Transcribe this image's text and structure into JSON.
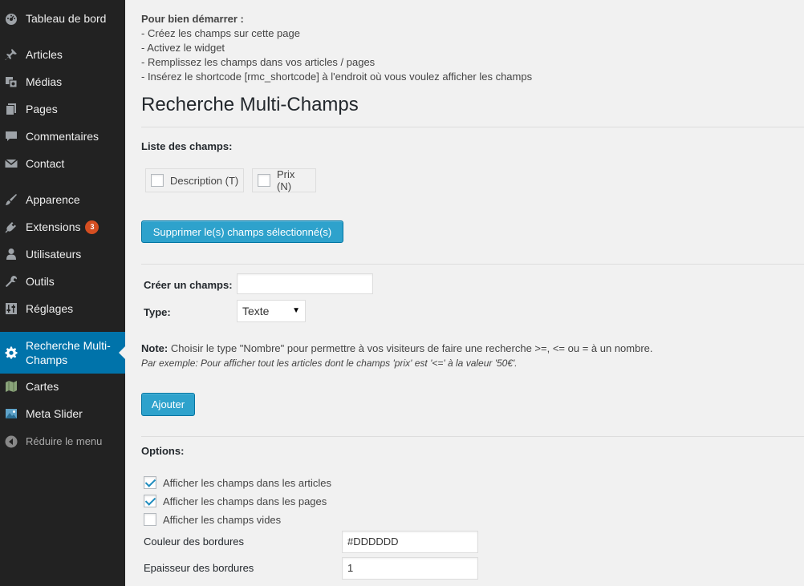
{
  "sidebar": {
    "items": [
      {
        "label": "Tableau de bord",
        "icon": "dashboard-icon"
      },
      {
        "label": "Articles",
        "icon": "pin-icon"
      },
      {
        "label": "Médias",
        "icon": "media-icon"
      },
      {
        "label": "Pages",
        "icon": "pages-icon"
      },
      {
        "label": "Commentaires",
        "icon": "comment-icon"
      },
      {
        "label": "Contact",
        "icon": "mail-icon"
      },
      {
        "label": "Apparence",
        "icon": "brush-icon"
      },
      {
        "label": "Extensions",
        "icon": "plugin-icon",
        "badge": "3"
      },
      {
        "label": "Utilisateurs",
        "icon": "user-icon"
      },
      {
        "label": "Outils",
        "icon": "wrench-icon"
      },
      {
        "label": "Réglages",
        "icon": "settings-sliders-icon"
      },
      {
        "label": "Recherche Multi-Champs",
        "icon": "gear-icon",
        "active": true
      },
      {
        "label": "Cartes",
        "icon": "map-icon"
      },
      {
        "label": "Meta Slider",
        "icon": "image-icon"
      }
    ],
    "collapse_label": "Réduire le menu"
  },
  "intro": {
    "title": "Pour bien démarrer :",
    "lines": [
      "- Créez les champs sur cette page",
      "- Activez le widget",
      "- Remplissez les champs dans vos articles / pages",
      "- Insérez le shortcode [rmc_shortcode] à l'endroit où vous voulez afficher les champs"
    ]
  },
  "page_title": "Recherche Multi-Champs",
  "fields_list": {
    "label": "Liste des champs:",
    "items": [
      {
        "label": "Description (T)",
        "checked": false
      },
      {
        "label": "Prix (N)",
        "checked": false
      }
    ],
    "delete_button": "Supprimer le(s) champs sélectionné(s)"
  },
  "create": {
    "name_label": "Créer un champs:",
    "name_value": "",
    "type_label": "Type:",
    "type_value": "Texte",
    "note_bold": "Note:",
    "note_text": " Choisir le type \"Nombre\" pour permettre à vos visiteurs de faire une recherche >=, <= ou = à un nombre.",
    "note_example": "Par exemple: Pour afficher tout les articles dont le champs 'prix' est '<=' à la valeur '50€'.",
    "add_button": "Ajouter"
  },
  "options": {
    "label": "Options:",
    "checkboxes": [
      {
        "label": "Afficher les champs dans les articles",
        "checked": true
      },
      {
        "label": "Afficher les champs dans les pages",
        "checked": true
      },
      {
        "label": "Afficher les champs vides",
        "checked": false
      }
    ],
    "border_color_label": "Couleur des bordures",
    "border_color_value": "#DDDDDD",
    "border_width_label": "Epaisseur des bordures",
    "border_width_value": "1"
  },
  "colors": {
    "sidebar_bg": "#222222",
    "active_bg": "#0073aa",
    "button_bg": "#2ea2cc",
    "badge_bg": "#d54e21",
    "check_color": "#1e8cbe"
  }
}
